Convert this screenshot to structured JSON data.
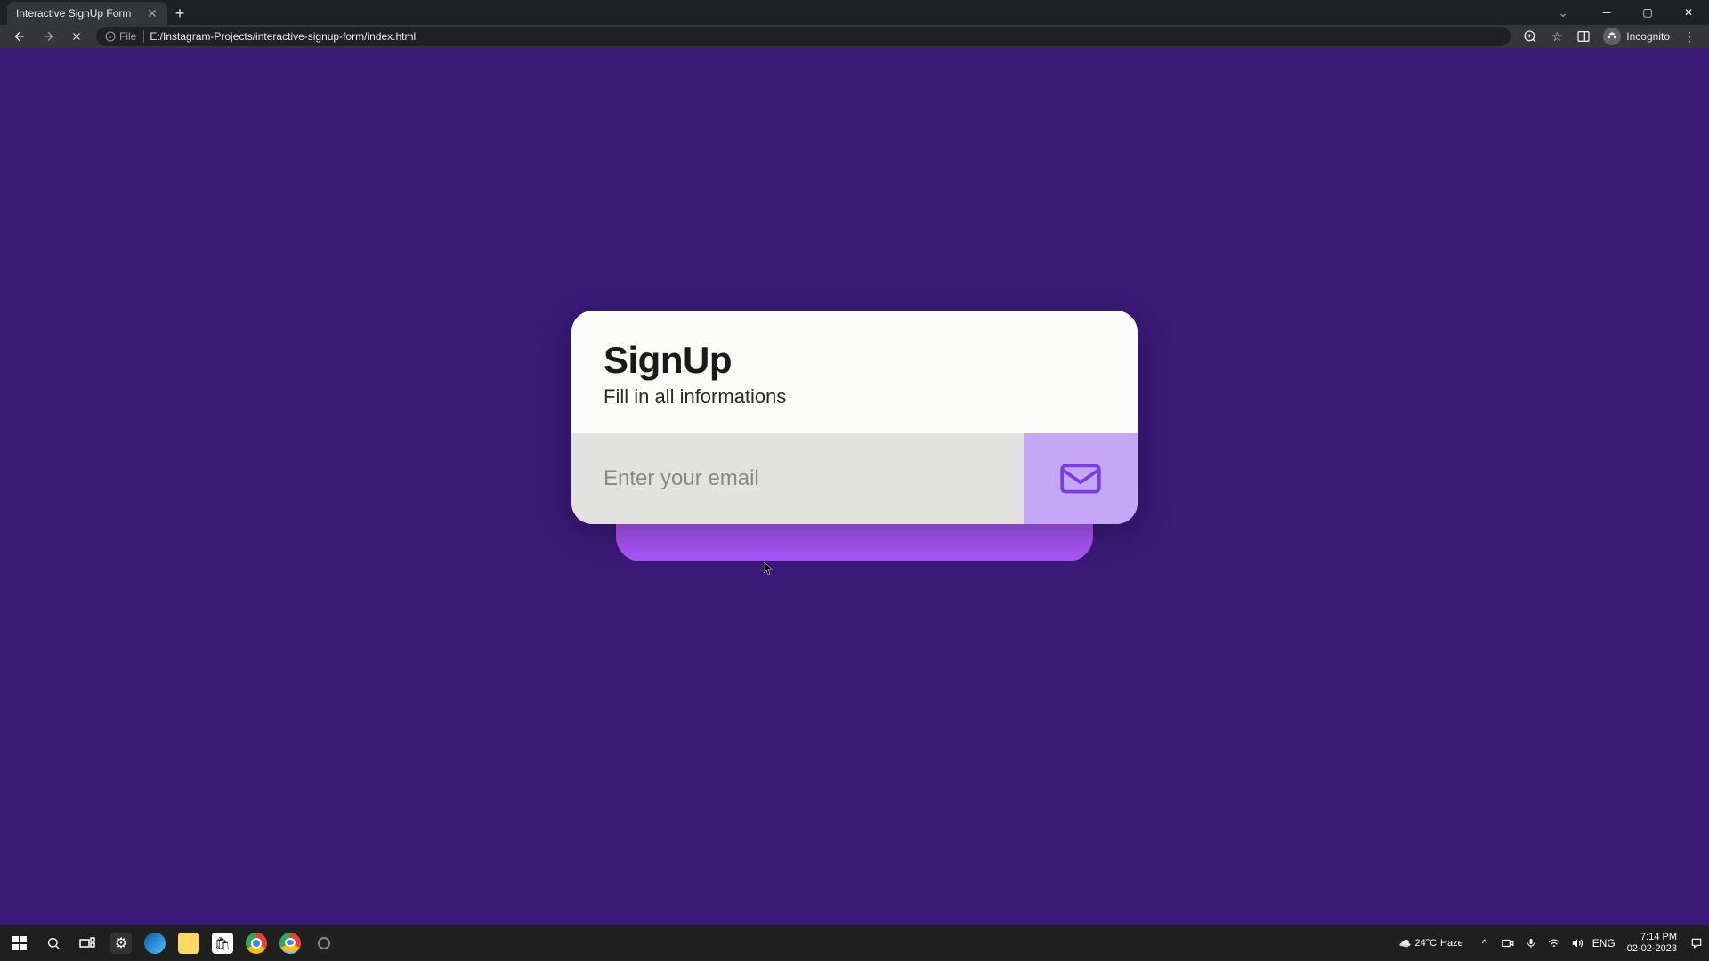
{
  "browser": {
    "tab_title": "Interactive SignUp Form",
    "address_prefix": "File",
    "address_path": "E:/Instagram-Projects/interactive-signup-form/index.html",
    "incognito_label": "Incognito"
  },
  "signup": {
    "title": "SignUp",
    "subtitle": "Fill in all informations",
    "email_placeholder": "Enter your email"
  },
  "taskbar": {
    "weather_temp": "24°C",
    "weather_cond": "Haze",
    "lang": "ENG",
    "time": "7:14 PM",
    "date": "02-02-2023"
  }
}
